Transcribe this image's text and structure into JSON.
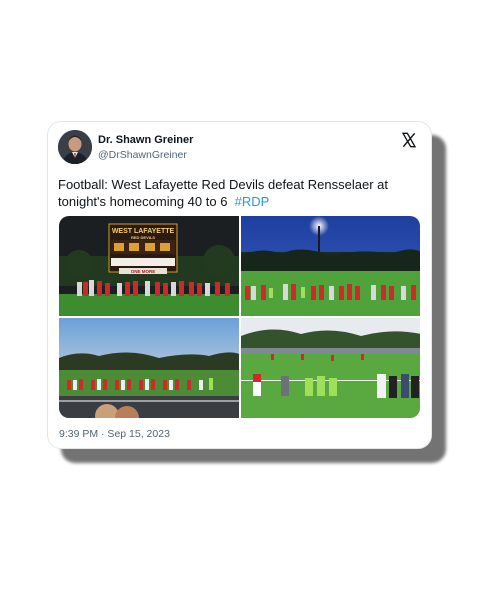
{
  "colors": {
    "text": "#0f1419",
    "secondary": "#536471",
    "link": "#1d9bf0",
    "card_bg": "#ffffff"
  },
  "author": {
    "name": "Dr. Shawn Greiner",
    "handle": "@DrShawnGreiner",
    "avatar_icon": "profile-photo"
  },
  "platform_icon": "x-logo-icon",
  "tweet": {
    "text": "Football: West Lafayette Red Devils defeat Rensselaer at tonight's homecoming 40 to 6",
    "hashtag": "#RDP"
  },
  "media": {
    "photos": [
      {
        "description_icon": "scoreboard-photo",
        "scoreboard_title": "WEST LAFAYETTE",
        "scoreboard_sub": "RED DEVILS",
        "scoreboard_banner": "ONE MORE"
      },
      {
        "description_icon": "stadium-lights-photo"
      },
      {
        "description_icon": "sunset-field-photo"
      },
      {
        "description_icon": "sideline-players-photo"
      }
    ]
  },
  "timestamp": "9:39 PM · Sep 15, 2023"
}
